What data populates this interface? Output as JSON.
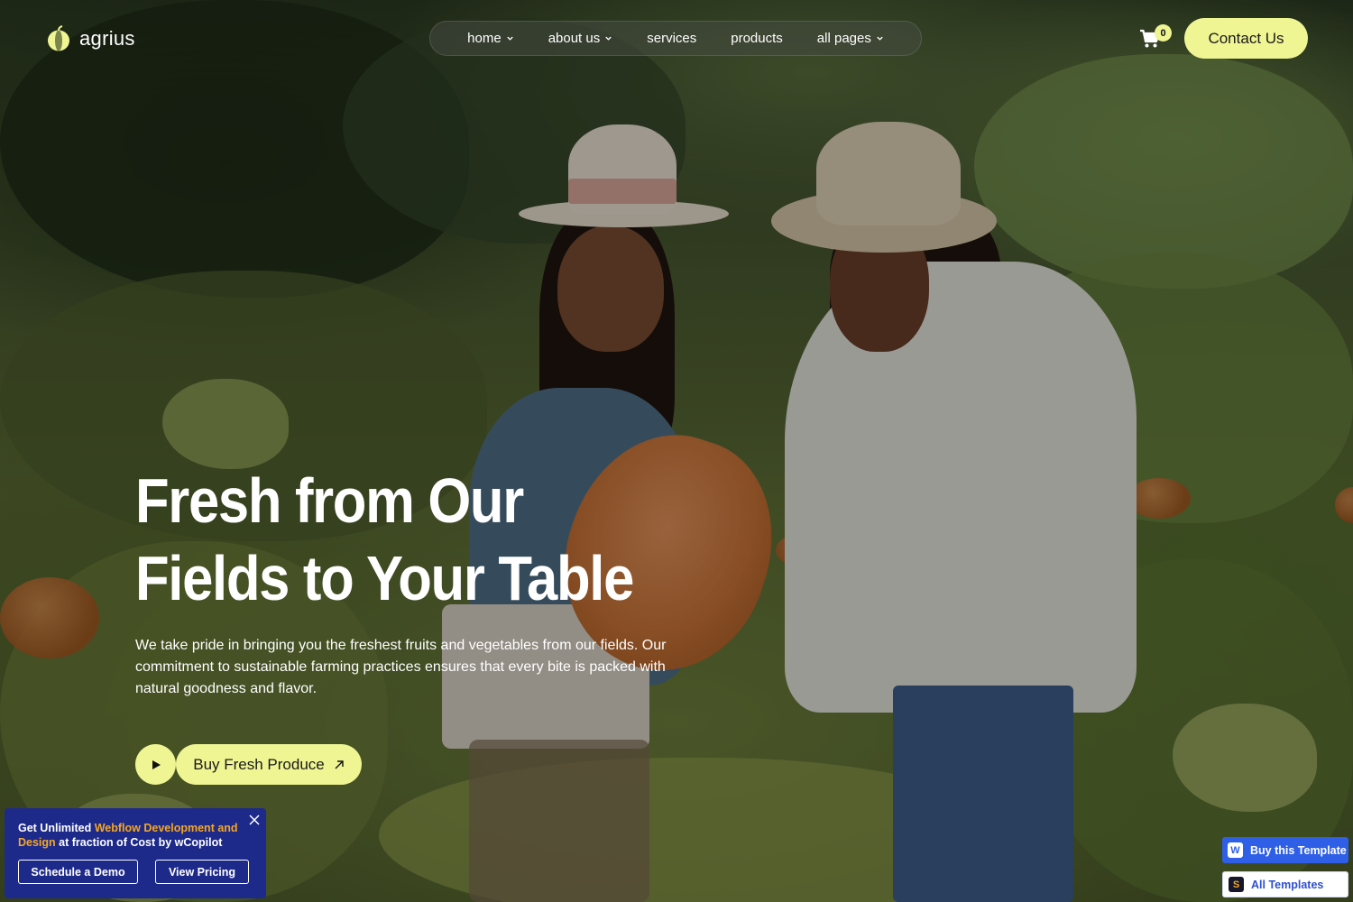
{
  "brand": {
    "name": "agrius",
    "accent": "#eff593"
  },
  "nav": {
    "items": [
      {
        "label": "home",
        "has_dropdown": true
      },
      {
        "label": "about us",
        "has_dropdown": true
      },
      {
        "label": "services",
        "has_dropdown": false
      },
      {
        "label": "products",
        "has_dropdown": false
      },
      {
        "label": "all pages",
        "has_dropdown": true
      }
    ]
  },
  "header": {
    "cart_count": "0",
    "cart_icon": "shopping-cart-icon",
    "contact_label": "Contact Us"
  },
  "hero": {
    "headline_line1": "Fresh from Our",
    "headline_line2": "Fields to Your Table",
    "description": "We take pride in bringing you the freshest fruits and vegetables from our fields. Our commitment to sustainable farming practices ensures that every bite is packed with natural goodness and flavor.",
    "play_icon": "play-icon",
    "cta_label": "Buy Fresh Produce",
    "cta_icon": "arrow-up-right-icon"
  },
  "promo": {
    "text_prefix": "Get Unlimited ",
    "text_highlight": "Webflow Development and Design",
    "text_suffix": " at fraction of Cost by wCopilot",
    "highlight_color": "#f5a623",
    "background_color": "#1e2a8a",
    "demo_label": "Schedule a Demo",
    "pricing_label": "View Pricing"
  },
  "template_badges": {
    "buy_label": "Buy this Template",
    "all_label": "All Templates"
  }
}
